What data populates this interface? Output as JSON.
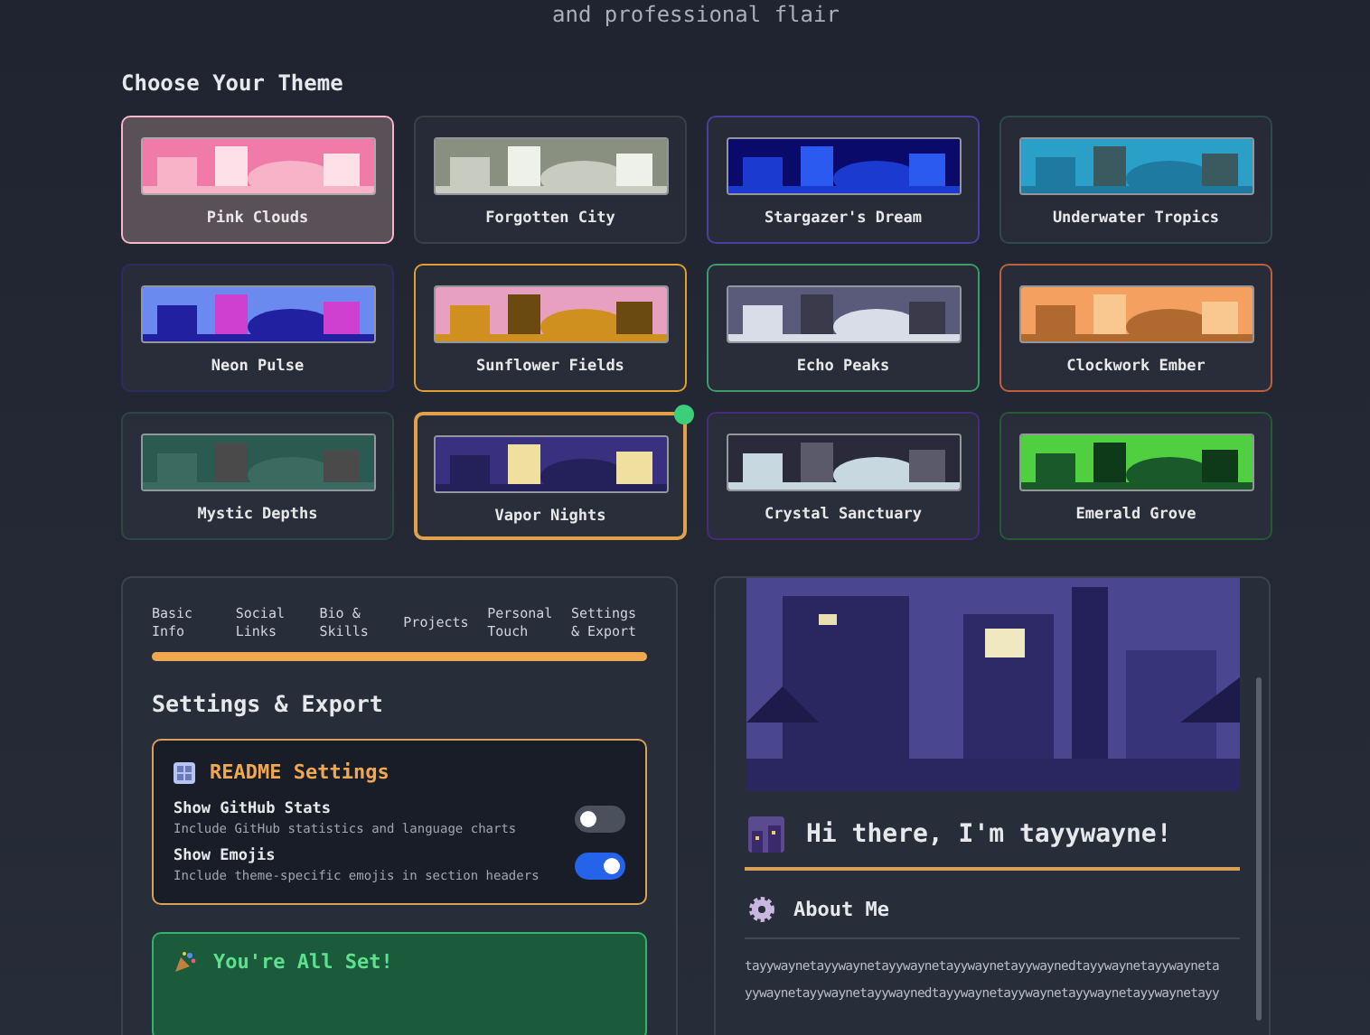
{
  "subtitle": "and professional flair",
  "theme_section": {
    "title": "Choose Your Theme",
    "themes": [
      {
        "name": "Pink Clouds",
        "color": "#f4b6c8",
        "selected": false,
        "highlighted": true
      },
      {
        "name": "Forgotten City",
        "color": "#3a4048",
        "selected": false,
        "highlighted": false
      },
      {
        "name": "Stargazer's Dream",
        "color": "#4b3f9e",
        "selected": false,
        "highlighted": false
      },
      {
        "name": "Underwater Tropics",
        "color": "#2e4a4a",
        "selected": false,
        "highlighted": false
      },
      {
        "name": "Neon Pulse",
        "color": "#2a2d5e",
        "selected": false,
        "highlighted": false
      },
      {
        "name": "Sunflower Fields",
        "color": "#e0a030",
        "selected": false,
        "highlighted": false
      },
      {
        "name": "Echo Peaks",
        "color": "#3f9a6a",
        "selected": false,
        "highlighted": false
      },
      {
        "name": "Clockwork Ember",
        "color": "#c0603a",
        "selected": false,
        "highlighted": false
      },
      {
        "name": "Mystic Depths",
        "color": "#2c4844",
        "selected": false,
        "highlighted": false
      },
      {
        "name": "Vapor Nights",
        "color": "#e3a04a",
        "selected": true,
        "highlighted": false
      },
      {
        "name": "Crystal Sanctuary",
        "color": "#4a2a7a",
        "selected": false,
        "highlighted": false
      },
      {
        "name": "Emerald Grove",
        "color": "#245a34",
        "selected": false,
        "highlighted": false
      }
    ]
  },
  "editor": {
    "steps": [
      {
        "label": "Basic Info"
      },
      {
        "label": "Social Links"
      },
      {
        "label": "Bio & Skills"
      },
      {
        "label": "Projects"
      },
      {
        "label": "Personal Touch"
      },
      {
        "label": "Settings & Export"
      }
    ],
    "progress": {
      "level": 1
    },
    "title": "Settings & Export",
    "settings_card": {
      "title": "README Settings",
      "options": [
        {
          "label": "Show GitHub Stats",
          "description": "Include GitHub statistics and language charts",
          "on": false
        },
        {
          "label": "Show Emojis",
          "description": "Include theme-specific emojis in section headers",
          "on": true
        }
      ]
    },
    "done_card": {
      "title": "You're All Set!"
    }
  },
  "preview": {
    "greeting": "Hi there, I'm tayywayne!",
    "section_title": "About Me",
    "about_lines": [
      "tayywaynetayywaynetayywaynetayywaynetayywaynedtayywaynetayywayneta",
      "yywaynetayywaynetayywaynedtayywaynetayywaynetayywaynetayywaynetayy"
    ]
  }
}
